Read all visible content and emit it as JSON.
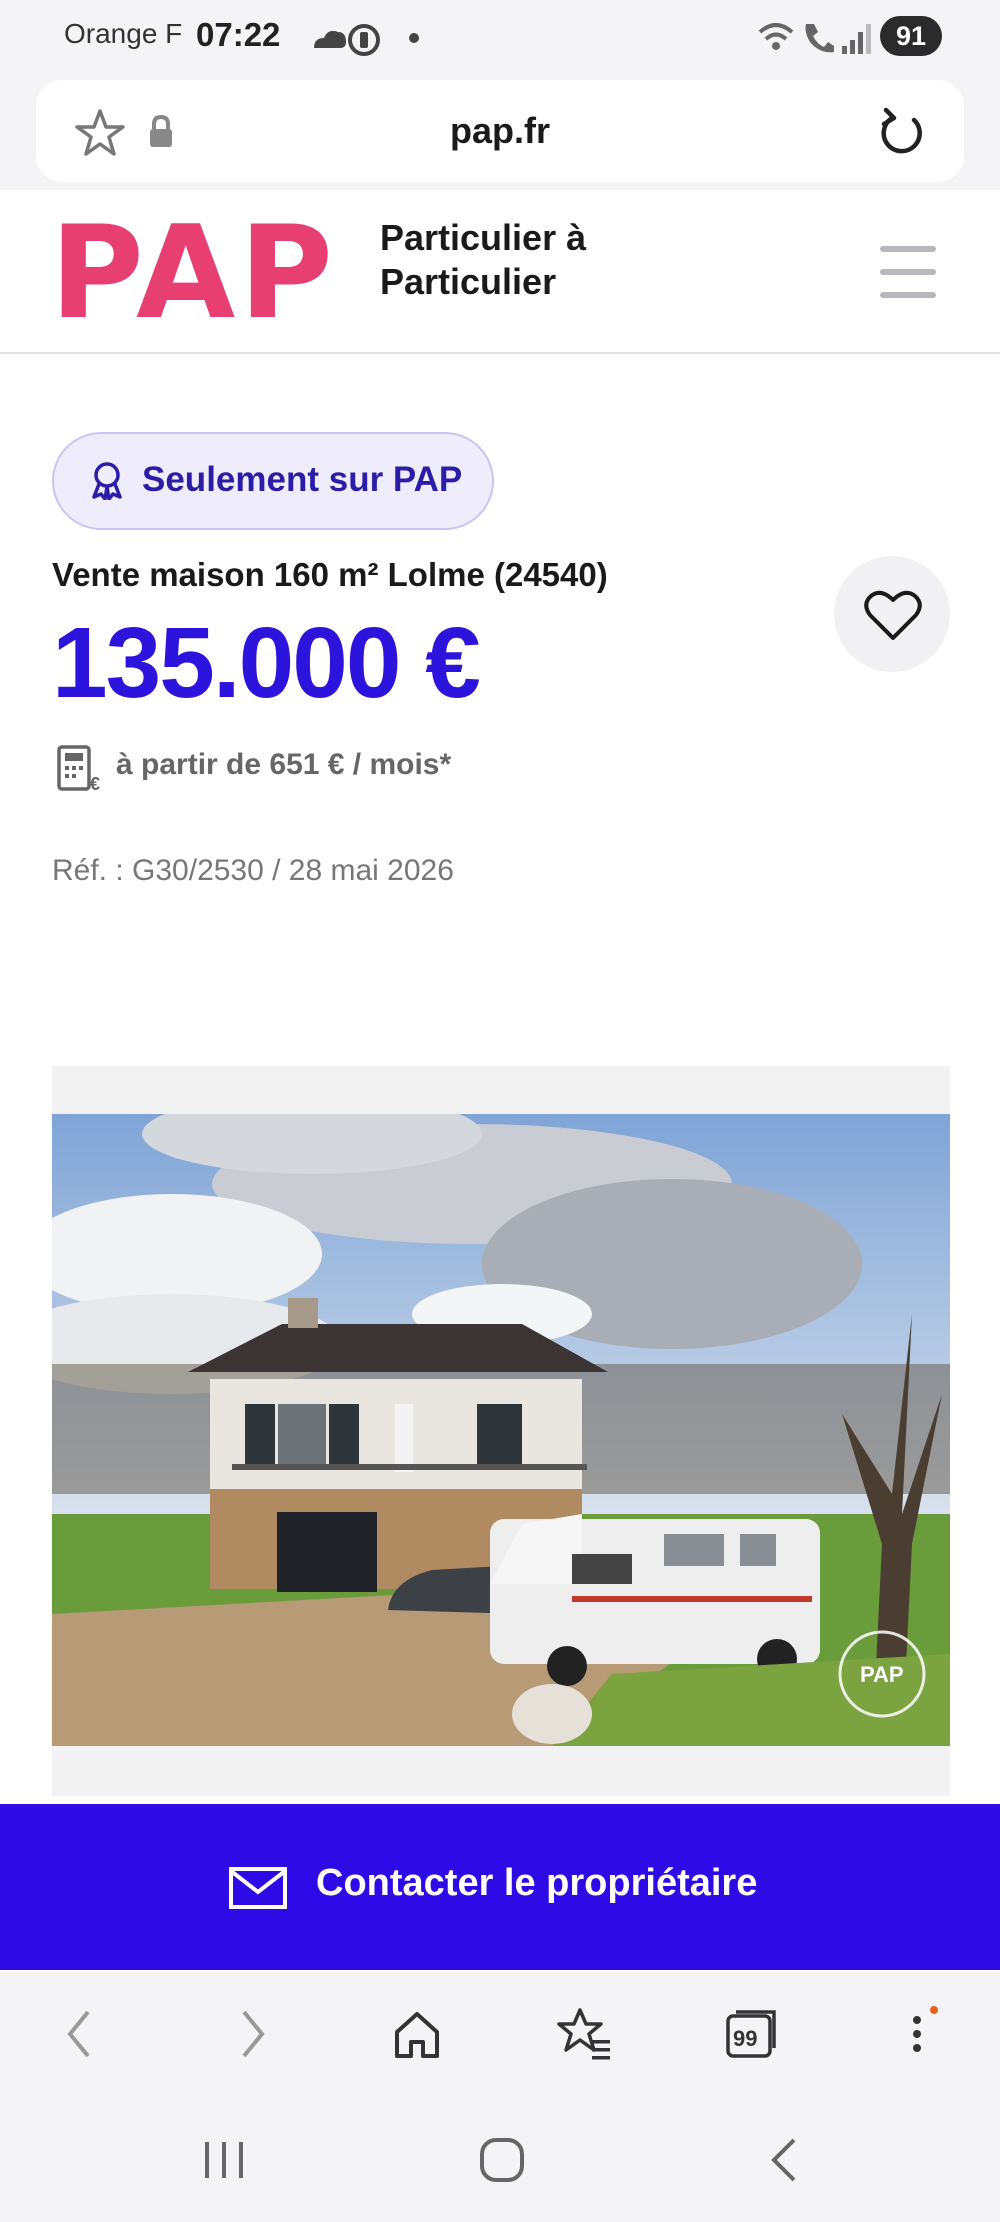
{
  "status_bar": {
    "carrier": "Orange F",
    "time": "07:22",
    "battery": "91"
  },
  "browser": {
    "url": "pap.fr"
  },
  "site": {
    "logo": "PAP",
    "tagline_line1": "Particulier à",
    "tagline_line2": "Particulier"
  },
  "listing": {
    "badge": "Seulement sur PAP",
    "title": "Vente maison 160 m² Lolme (24540)",
    "price": "135.000 €",
    "monthly": "à partir de 651 € / mois*",
    "reference": "Réf. : G30/2530 / 28 mai 2026",
    "photo_watermark": "PAP"
  },
  "contact": {
    "label": "Contacter le propriétaire"
  },
  "colors": {
    "brand_pink": "#e83f72",
    "accent_blue": "#2d14dd",
    "contact_bar": "#2d0ae6"
  }
}
